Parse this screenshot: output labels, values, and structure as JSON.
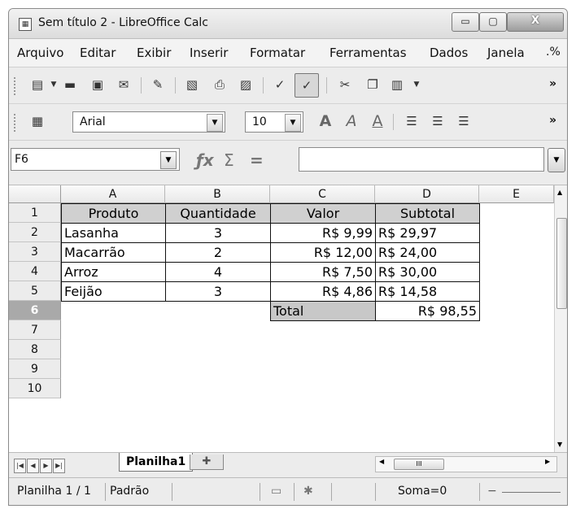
{
  "window": {
    "title": "Sem título 2 - LibreOffice Calc",
    "min_label": "▭",
    "max_label": "▢",
    "close_label": "X"
  },
  "menu": {
    "items": [
      "Arquivo",
      "Editar",
      "Exibir",
      "Inserir",
      "Formatar",
      "Ferramentas",
      "Dados",
      "Janela"
    ],
    "more": ".%"
  },
  "toolbar": {
    "font_name": "Arial",
    "font_size": "10",
    "overflow": "»"
  },
  "formula_bar": {
    "name_box": "F6",
    "content": ""
  },
  "sheet": {
    "columns": [
      "A",
      "B",
      "C",
      "D",
      "E"
    ],
    "rows": [
      "1",
      "2",
      "3",
      "4",
      "5",
      "6",
      "7",
      "8",
      "9",
      "10"
    ],
    "selected_row": "6",
    "header": [
      "Produto",
      "Quantidade",
      "Valor",
      "Subtotal"
    ],
    "data": [
      [
        "Lasanha",
        "3",
        "R$ 9,99",
        "R$ 29,97"
      ],
      [
        "Macarrão",
        "2",
        "R$ 12,00",
        "R$ 24,00"
      ],
      [
        "Arroz",
        "4",
        "R$ 7,50",
        "R$ 30,00"
      ],
      [
        "Feijão",
        "3",
        "R$ 4,86",
        "R$ 14,58"
      ]
    ],
    "total_label": "Total",
    "total_value": "R$ 98,55"
  },
  "tabs": {
    "active": "Planilha1",
    "hscroll_label": "III"
  },
  "status": {
    "sheet_info": "Planilha 1 / 1",
    "style": "Padrão",
    "sum": "Soma=0"
  }
}
